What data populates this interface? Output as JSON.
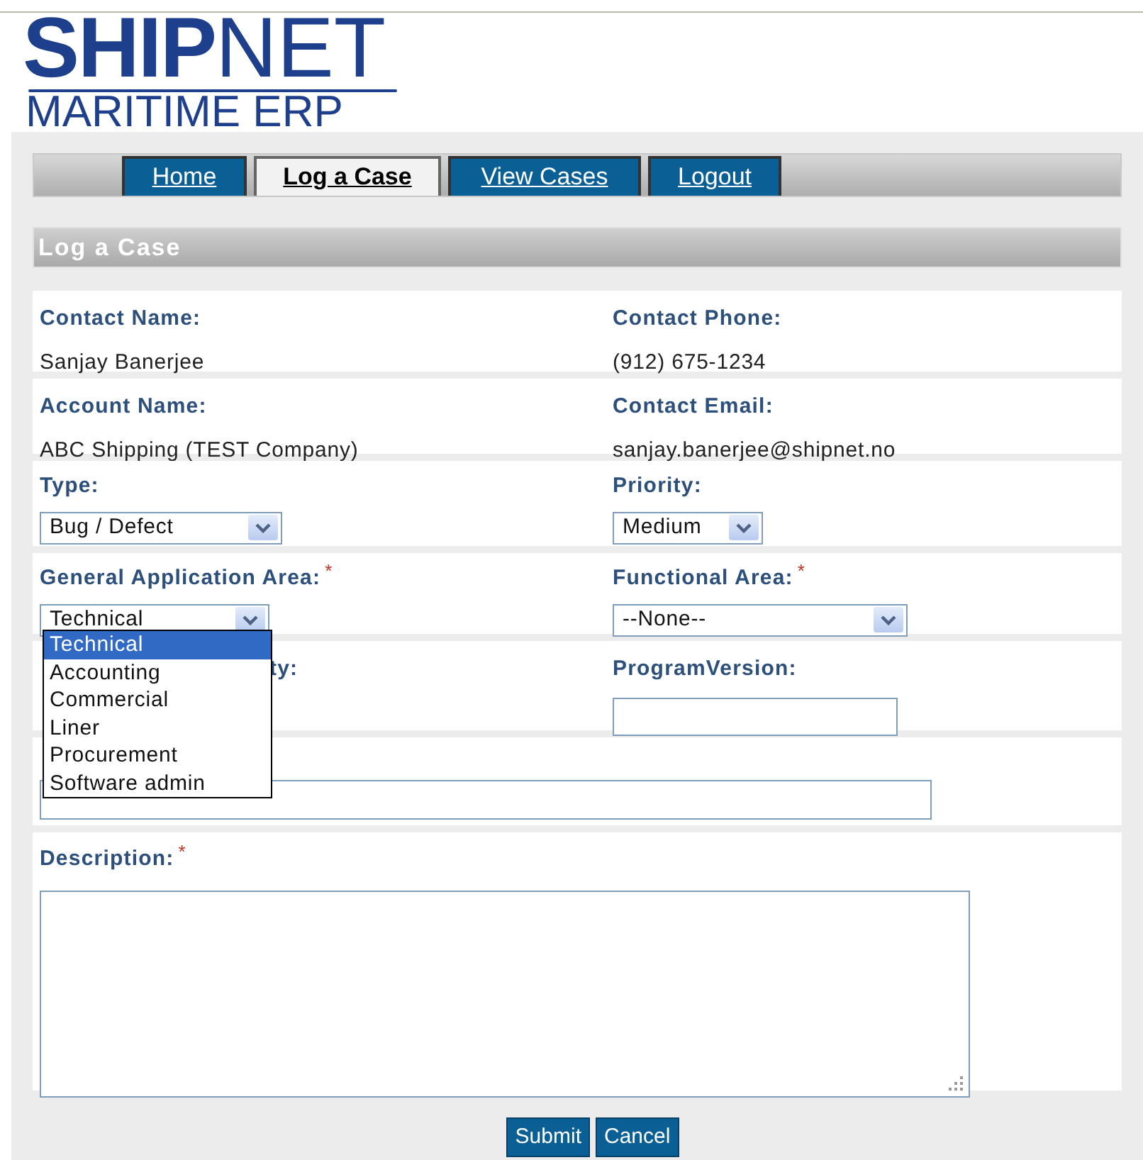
{
  "logo": {
    "brand_bold": "SHIP",
    "brand_light": "NET",
    "tagline": "MARITIME ERP"
  },
  "nav_tabs": [
    {
      "label": "Home",
      "selected": false
    },
    {
      "label": "Log a Case",
      "selected": true
    },
    {
      "label": "View Cases",
      "selected": false
    },
    {
      "label": "Logout",
      "selected": false
    }
  ],
  "section_title": "Log a Case",
  "rows": [
    [
      {
        "kind": "text",
        "label": "Contact Name:",
        "value": "Sanjay Banerjee"
      },
      {
        "kind": "text",
        "label": "Contact Phone:",
        "value": "(912) 675-1234"
      }
    ],
    [
      {
        "kind": "text",
        "label": "Account Name:",
        "value": "ABC Shipping (TEST Company)"
      },
      {
        "kind": "text",
        "label": "Contact Email:",
        "value": "sanjay.banerjee@shipnet.no"
      }
    ],
    [
      {
        "kind": "select",
        "label": "Type:",
        "value": "Bug / Defect"
      },
      {
        "kind": "select",
        "label": "Priority:",
        "value": "Medium"
      }
    ],
    [
      {
        "kind": "select",
        "label": "General Application Area:",
        "value": "Technical",
        "required_mark": "*"
      },
      {
        "kind": "select",
        "label": "Functional Area:",
        "value": "--None--",
        "required_mark": "*"
      }
    ],
    [
      {
        "kind": "partial_label",
        "label": "ty:"
      },
      {
        "kind": "input",
        "label": "ProgramVersion:"
      }
    ],
    [
      {
        "kind": "wide_input"
      }
    ],
    [
      {
        "kind": "textarea",
        "label": "Description:",
        "required_mark": "*"
      }
    ]
  ],
  "dropdown_list": {
    "options": [
      {
        "label": "Technical",
        "selected": true
      },
      {
        "label": "Accounting",
        "selected": false
      },
      {
        "label": "Commercial",
        "selected": false
      },
      {
        "label": "Liner",
        "selected": false
      },
      {
        "label": "Procurement",
        "selected": false
      },
      {
        "label": "Software admin",
        "selected": false
      }
    ]
  },
  "buttons": [
    "Submit",
    "Cancel"
  ]
}
